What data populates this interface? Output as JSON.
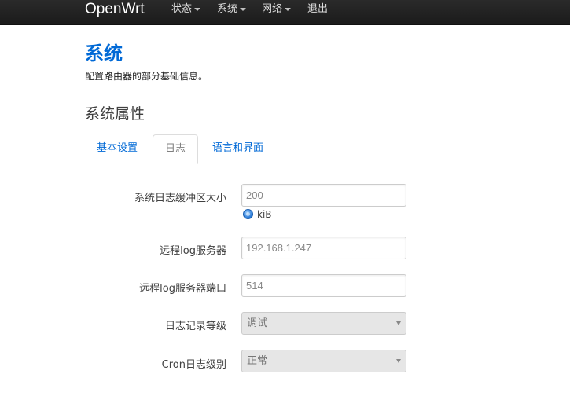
{
  "navbar": {
    "brand": "OpenWrt",
    "menu": [
      {
        "label": "状态",
        "has_dropdown": true
      },
      {
        "label": "系统",
        "has_dropdown": true
      },
      {
        "label": "网络",
        "has_dropdown": true
      },
      {
        "label": "退出",
        "has_dropdown": false
      }
    ]
  },
  "page": {
    "title": "系统",
    "description": "配置路由器的部分基础信息。",
    "section_title": "系统属性"
  },
  "tabs": [
    {
      "label": "基本设置",
      "active": false
    },
    {
      "label": "日志",
      "active": true
    },
    {
      "label": "语言和界面",
      "active": false
    }
  ],
  "form": {
    "log_buffer_size": {
      "label": "系统日志缓冲区大小",
      "value": "200",
      "hint": "kiB"
    },
    "remote_log_server": {
      "label": "远程log服务器",
      "value": "192.168.1.247"
    },
    "remote_log_port": {
      "label": "远程log服务器端口",
      "value": "514"
    },
    "log_level": {
      "label": "日志记录等级",
      "value": "调试"
    },
    "cron_log_level": {
      "label": "Cron日志级别",
      "value": "正常"
    }
  },
  "colors": {
    "navbar_bg": "#1b1b1b",
    "link_blue": "#0069d6",
    "select_bg": "#e6e6e6"
  },
  "icons": {
    "hint_icon": "info-dot-icon",
    "dropdown_caret": "caret-down-icon"
  }
}
